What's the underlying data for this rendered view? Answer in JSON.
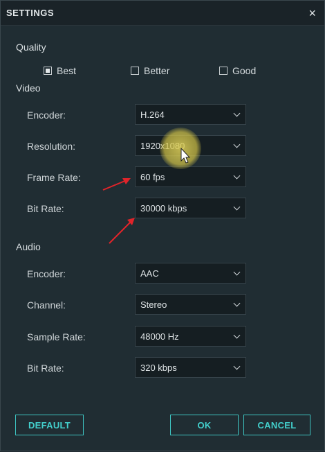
{
  "dialog": {
    "title": "SETTINGS",
    "close_symbol": "×"
  },
  "quality": {
    "label": "Quality",
    "options": [
      {
        "label": "Best",
        "checked": true
      },
      {
        "label": "Better",
        "checked": false
      },
      {
        "label": "Good",
        "checked": false
      }
    ]
  },
  "video": {
    "label": "Video",
    "fields": [
      {
        "label": "Encoder:",
        "value": "H.264"
      },
      {
        "label": "Resolution:",
        "value": "1920x1080"
      },
      {
        "label": "Frame Rate:",
        "value": "60 fps"
      },
      {
        "label": "Bit Rate:",
        "value": "30000 kbps"
      }
    ]
  },
  "audio": {
    "label": "Audio",
    "fields": [
      {
        "label": "Encoder:",
        "value": "AAC"
      },
      {
        "label": "Channel:",
        "value": "Stereo"
      },
      {
        "label": "Sample Rate:",
        "value": "48000 Hz"
      },
      {
        "label": "Bit Rate:",
        "value": "320 kbps"
      }
    ]
  },
  "buttons": {
    "default": "DEFAULT",
    "ok": "OK",
    "cancel": "CANCEL"
  },
  "colors": {
    "accent": "#43d0cd",
    "annotation_arrow": "#e0242a",
    "cursor_highlight": "#e0d25a"
  },
  "icons": {
    "dropdown": "chevron-down-icon",
    "cursor": "mouse-pointer-icon"
  }
}
